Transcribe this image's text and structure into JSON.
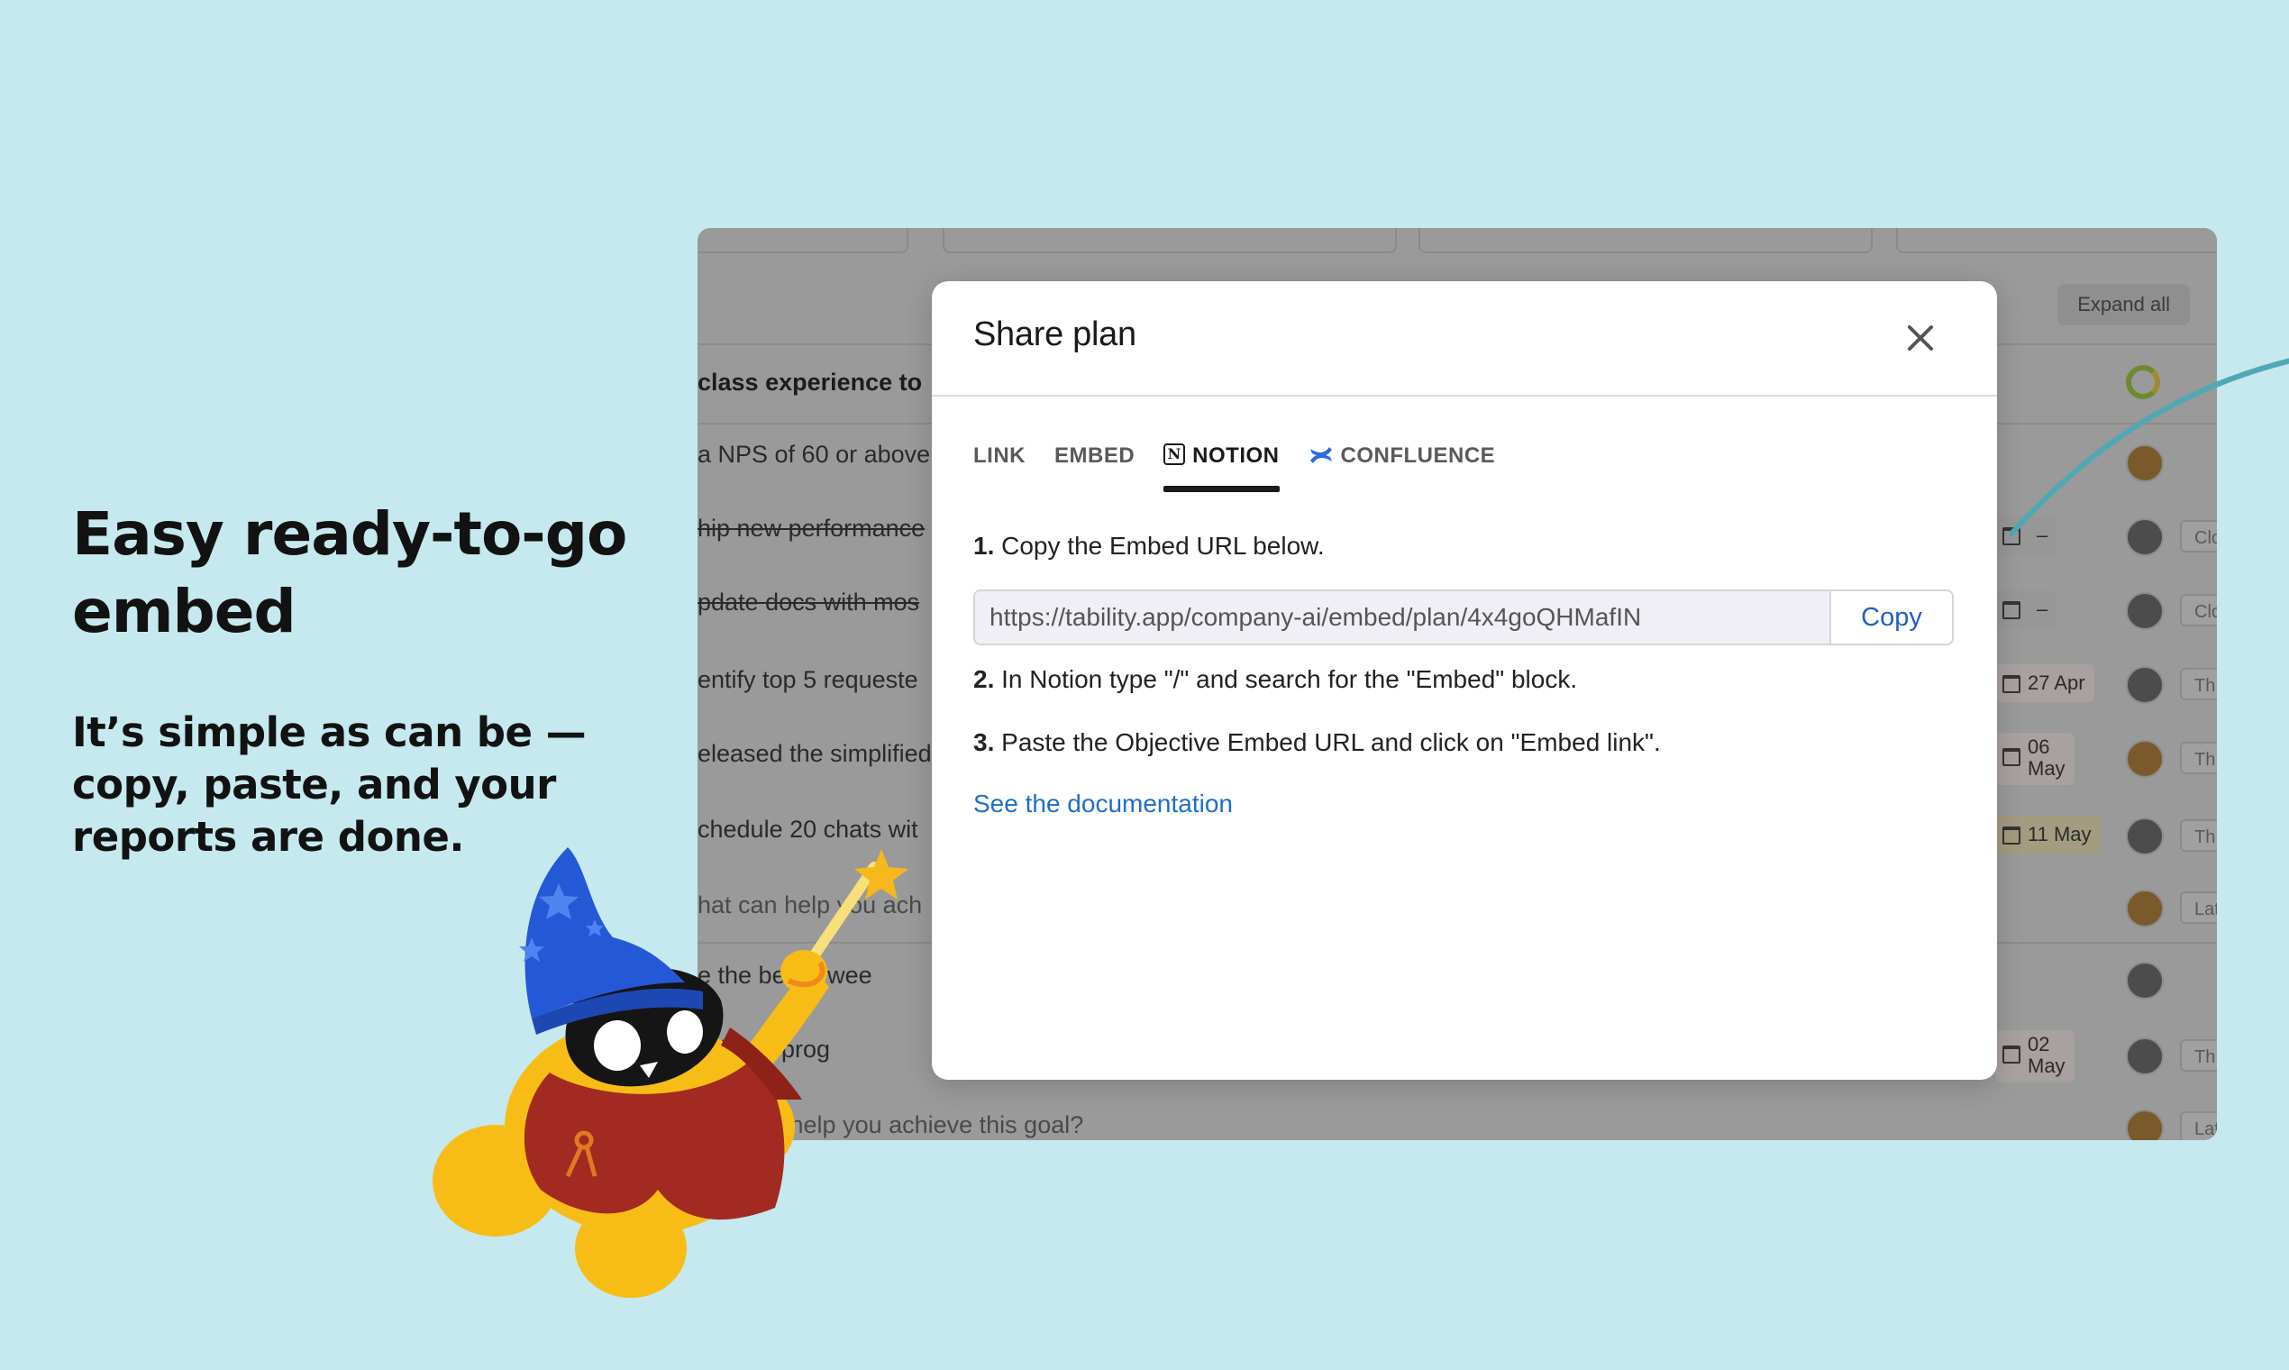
{
  "hero": {
    "title_line1": "Easy ready-to-go",
    "title_line2": "embed",
    "sub_line1": "It’s simple as can be —",
    "sub_line2": "copy, paste, and your",
    "sub_line3": "reports are done."
  },
  "app": {
    "expand_label": "Expand all",
    "rows": [
      "class experience to",
      "a NPS of 60 or above",
      "hip new performance",
      "pdate docs with mos",
      "entify top 5 requeste",
      "eleased the simplified",
      "chedule 20 chats wit",
      "hat can help you ach",
      "e the   ber of wee",
      "referral prog",
      "n help you achieve this goal?"
    ],
    "dates": {
      "d1": "–",
      "d2": "–",
      "d3": "27 Apr",
      "d4_day": "06",
      "d4_month": "May",
      "d5": "11 May",
      "d6_day": "02",
      "d6_month": "May"
    },
    "pills": [
      "Clo",
      "Clo",
      "Th",
      "Th",
      "Th",
      "Lat",
      "Th",
      "Lat"
    ]
  },
  "modal": {
    "title": "Share plan",
    "tabs": [
      "LINK",
      "EMBED",
      "NOTION",
      "CONFLUENCE"
    ],
    "active_tab": "NOTION",
    "step1_num": "1.",
    "step1_text": "Copy the Embed URL below.",
    "url": "https://tability.app/company-ai/embed/plan/4x4goQHMafIN",
    "copy_label": "Copy",
    "step2_num": "2.",
    "step2_text": "In Notion type \"/\" and search for the \"Embed\" block.",
    "step3_num": "3.",
    "step3_text": "Paste the Objective Embed URL and click on \"Embed link\".",
    "doc_link": "See the documentation"
  },
  "colors": {
    "background": "#c5e9ee",
    "link": "#1f6fc4",
    "confluence": "#2f6be0"
  }
}
